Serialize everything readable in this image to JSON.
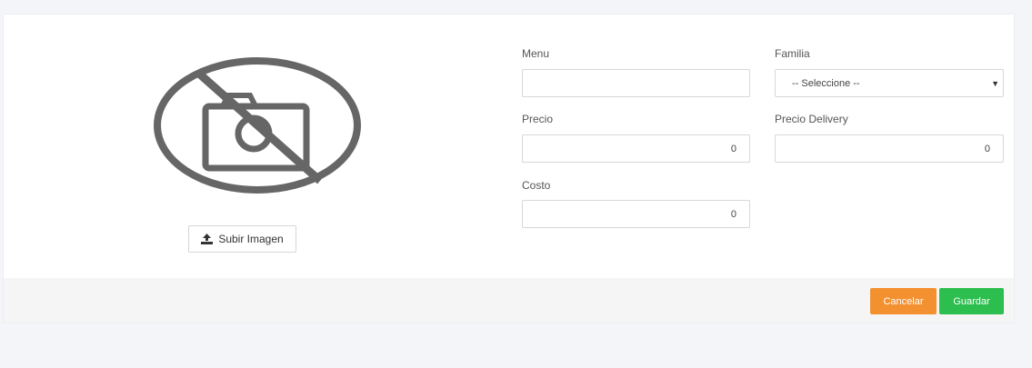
{
  "image_panel": {
    "placeholder_icon": "no-photo-icon",
    "upload_icon": "upload-icon",
    "upload_label": "Subir Imagen",
    "placeholder_color": "#666666"
  },
  "form": {
    "menu": {
      "label": "Menu",
      "value": "",
      "placeholder": ""
    },
    "familia": {
      "label": "Familia",
      "selected": "-- Seleccione --"
    },
    "precio": {
      "label": "Precio",
      "value": "0"
    },
    "precio_delivery": {
      "label": "Precio Delivery",
      "value": "0"
    },
    "costo": {
      "label": "Costo",
      "value": "0"
    }
  },
  "footer": {
    "cancel_label": "Cancelar",
    "save_label": "Guardar",
    "cancel_color": "#f39131",
    "save_color": "#2cbe4e"
  }
}
